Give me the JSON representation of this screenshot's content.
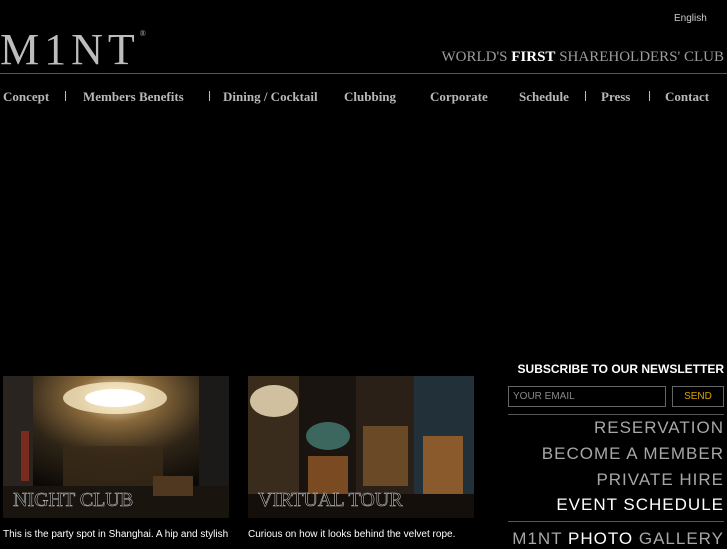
{
  "header": {
    "language": "English",
    "logo": "M1NT",
    "logo_mark": "®",
    "tagline_pre": "WORLD'S",
    "tagline_highlight": "FIRST",
    "tagline_post": "SHAREHOLDERS' CLUB"
  },
  "nav": {
    "items": [
      {
        "label": "Concept"
      },
      {
        "label": "Members Benefits"
      },
      {
        "label": "Dining / Cocktail"
      },
      {
        "label": "Clubbing"
      },
      {
        "label": "Corporate"
      },
      {
        "label": "Schedule"
      },
      {
        "label": "Press"
      },
      {
        "label": "Contact"
      }
    ]
  },
  "features": [
    {
      "label": "NIGHT CLUB",
      "caption": "This is the party spot in Shanghai. A hip and stylish"
    },
    {
      "label": "VIRTUAL TOUR",
      "caption": "Curious on how it looks behind the velvet rope."
    }
  ],
  "newsletter": {
    "title": "SUBSCRIBE TO OUR NEWSLETTER",
    "placeholder": "YOUR EMAIL",
    "send_label": "SEND",
    "send_color": "#d8a300"
  },
  "side_links": [
    {
      "label": "RESERVATION"
    },
    {
      "label": "BECOME A MEMBER"
    },
    {
      "label": "PRIVATE HIRE"
    },
    {
      "label": "EVENT SCHEDULE"
    }
  ],
  "gallery": {
    "pre": "M1NT",
    "highlight": "PHOTO",
    "post": "GALLERY"
  }
}
